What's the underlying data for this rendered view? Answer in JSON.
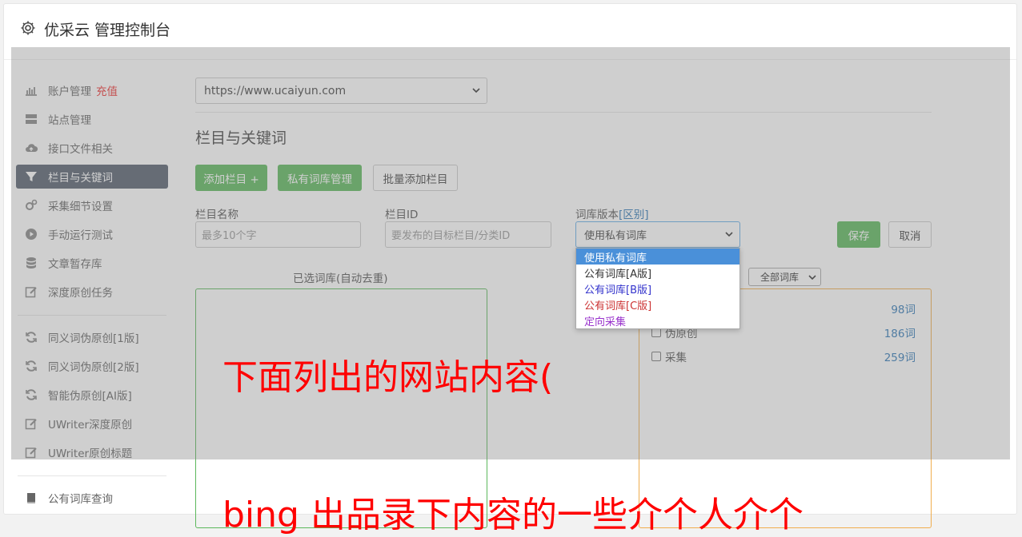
{
  "header": {
    "title": "优采云 管理控制台",
    "icon": "gear-icon"
  },
  "sidebar": {
    "items": [
      {
        "label": "账户管理",
        "extra": "充值",
        "icon": "bar-chart-icon"
      },
      {
        "label": "站点管理",
        "icon": "server-icon"
      },
      {
        "label": "接口文件相关",
        "icon": "cloud-upload-icon"
      },
      {
        "label": "栏目与关键词",
        "icon": "filter-icon",
        "active": true
      },
      {
        "label": "采集细节设置",
        "icon": "cogs-icon"
      },
      {
        "label": "手动运行测试",
        "icon": "play-circle-icon"
      },
      {
        "label": "文章暂存库",
        "icon": "database-icon"
      },
      {
        "label": "深度原创任务",
        "icon": "edit-icon"
      },
      {
        "label": "同义词伪原创[1版]",
        "icon": "refresh-icon"
      },
      {
        "label": "同义词伪原创[2版]",
        "icon": "refresh-icon"
      },
      {
        "label": "智能伪原创[AI版]",
        "icon": "refresh-icon"
      },
      {
        "label": "UWriter深度原创",
        "icon": "edit-icon"
      },
      {
        "label": "UWriter原创标题",
        "icon": "edit-icon"
      },
      {
        "label": "公有词库查询",
        "icon": "book-icon"
      }
    ]
  },
  "main": {
    "site_select": "https://www.ucaiyun.com",
    "section_title": "栏目与关键词",
    "buttons": {
      "add_column": "添加栏目 +",
      "private_lib": "私有词库管理",
      "batch_add": "批量添加栏目"
    },
    "form": {
      "name_label": "栏目名称",
      "name_placeholder": "最多10个字",
      "id_label": "栏目ID",
      "id_placeholder": "要发布的目标栏目/分类ID",
      "version_label": "词库版本",
      "version_link": "[区别]",
      "version_selected": "使用私有词库",
      "save": "保存",
      "cancel": "取消"
    },
    "version_options": [
      {
        "label": "使用私有词库",
        "color": "#ffffff"
      },
      {
        "label": "公有词库[A版]",
        "color": "#333333"
      },
      {
        "label": "公有词库[B版]",
        "color": "#3333cc"
      },
      {
        "label": "公有词库[C版]",
        "color": "#cc3333"
      },
      {
        "label": "定向采集",
        "color": "#9933cc"
      }
    ],
    "selected_caption": "已选词库(自动去重)",
    "filter_select": "全部词库",
    "libraries": [
      {
        "label": "",
        "count": "98词"
      },
      {
        "label": "伪原创",
        "count": "186词"
      },
      {
        "label": "采集",
        "count": "259词"
      }
    ]
  },
  "overlay_text": {
    "line1": "下面列出的网站内容(",
    "line2": "bing 出品录下内容的一些介个人介个"
  }
}
